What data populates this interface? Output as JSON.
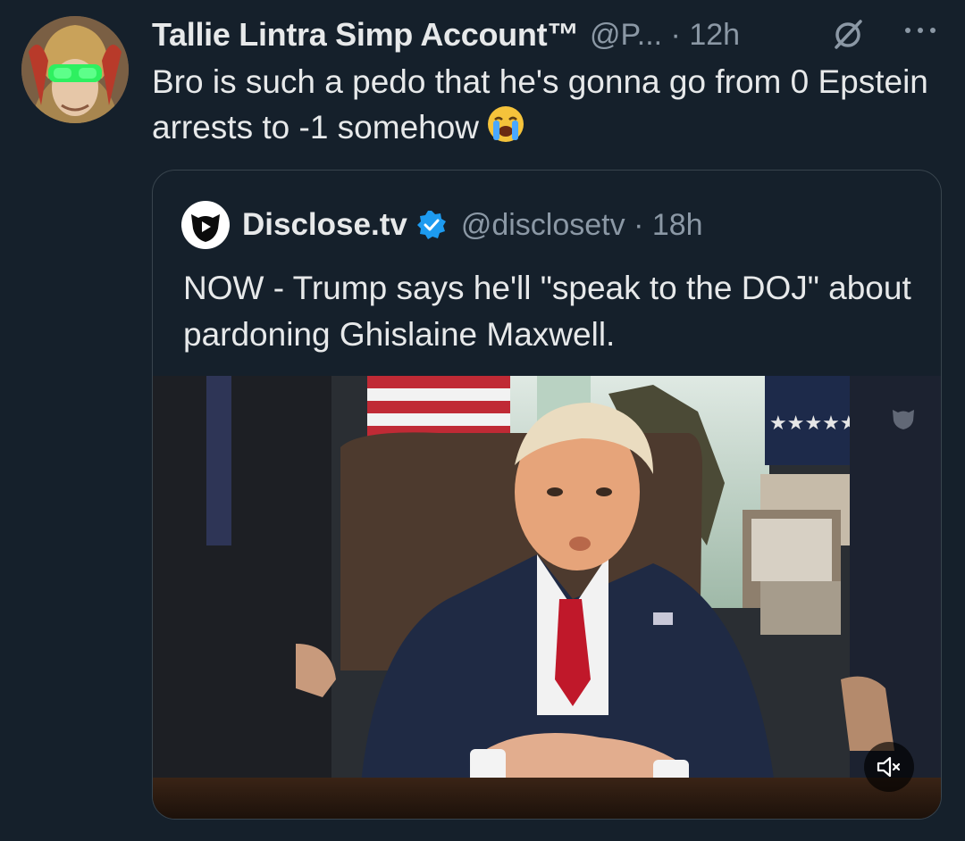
{
  "tweet": {
    "display_name": "Tallie Lintra Simp Account™",
    "handle_time": "@P... · 12h",
    "text": "Bro is such a pedo that he's gonna go from 0 Epstein arrests to -1 somehow",
    "emoji_icon": "loudly-crying-face-icon"
  },
  "quoted": {
    "display_name": "Disclose.tv",
    "handle": "@disclosetv",
    "time": "· 18h",
    "text": "NOW - Trump says he'll \"speak to the DOJ\" about pardoning Ghislaine Maxwell.",
    "verified": true,
    "media_icon": "mute-icon"
  },
  "colors": {
    "background": "#15202b",
    "text": "#e7e9ea",
    "muted": "#8b98a5",
    "verified": "#1d9bf0",
    "border": "#38444d"
  }
}
